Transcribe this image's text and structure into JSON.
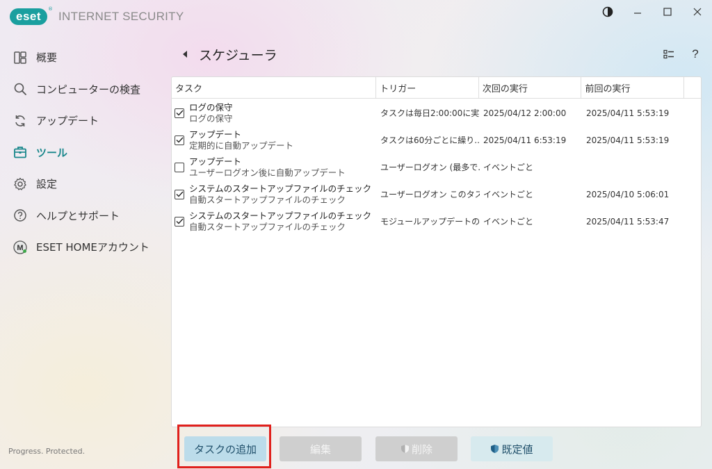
{
  "app": {
    "logo_text": "eset",
    "logo_mark": "®",
    "product_name": "INTERNET SECURITY"
  },
  "window_controls": [
    {
      "name": "theme-contrast-icon"
    },
    {
      "name": "minimize-icon"
    },
    {
      "name": "maximize-icon"
    },
    {
      "name": "close-icon"
    }
  ],
  "sidebar": {
    "items": [
      {
        "label": "概要",
        "icon": "dashboard-icon",
        "active": false
      },
      {
        "label": "コンピューターの検査",
        "icon": "search-icon",
        "active": false
      },
      {
        "label": "アップデート",
        "icon": "refresh-icon",
        "active": false
      },
      {
        "label": "ツール",
        "icon": "toolbox-icon",
        "active": true
      },
      {
        "label": "設定",
        "icon": "gear-icon",
        "active": false
      },
      {
        "label": "ヘルプとサポート",
        "icon": "question-icon",
        "active": false
      },
      {
        "label": "ESET HOMEアカウント",
        "icon": "eset-home-icon",
        "active": false
      }
    ],
    "footer": "Progress. Protected."
  },
  "header": {
    "title": "スケジューラ"
  },
  "table": {
    "columns": [
      "タスク",
      "トリガー",
      "次回の実行",
      "前回の実行"
    ],
    "rows": [
      {
        "checked": true,
        "name": "ログの保守",
        "desc": "ログの保守",
        "trigger": "タスクは毎日2:00:00に実...",
        "next": "2025/04/12 2:00:00",
        "last": "2025/04/11 5:53:19"
      },
      {
        "checked": true,
        "name": "アップデート",
        "desc": "定期的に自動アップデート",
        "trigger": "タスクは60分ごとに繰り...",
        "next": "2025/04/11 6:53:19",
        "last": "2025/04/11 5:53:19"
      },
      {
        "checked": false,
        "name": "アップデート",
        "desc": "ユーザーログオン後に自動アップデート",
        "trigger": "ユーザーログオン (最多で...",
        "next": "イベントごと",
        "last": ""
      },
      {
        "checked": true,
        "name": "システムのスタートアップファイルのチェック",
        "desc": "自動スタートアップファイルのチェック",
        "trigger": "ユーザーログオン このタス...",
        "next": "イベントごと",
        "last": "2025/04/10 5:06:01"
      },
      {
        "checked": true,
        "name": "システムのスタートアップファイルのチェック",
        "desc": "自動スタートアップファイルのチェック",
        "trigger": "モジュールアップデートの...",
        "next": "イベントごと",
        "last": "2025/04/11 5:53:47"
      }
    ]
  },
  "buttons": {
    "add": "タスクの追加",
    "edit": "編集",
    "delete": "削除",
    "default": "既定値"
  },
  "colors": {
    "accent": "#17868a",
    "highlight": "#e0201c"
  }
}
